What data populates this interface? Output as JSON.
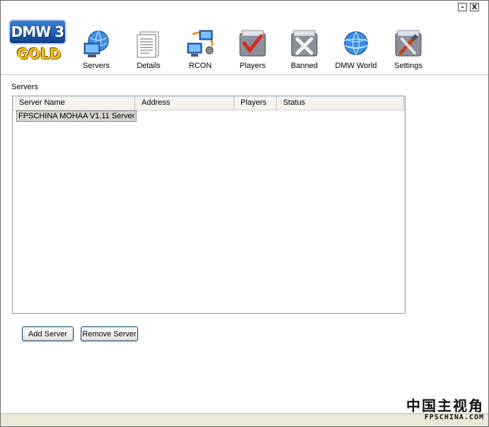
{
  "window": {
    "minimize_label": "-",
    "close_label": "X"
  },
  "logo": {
    "title": "DMW 3",
    "subtitle": "GOLD"
  },
  "toolbar": {
    "items": [
      {
        "label": "Servers",
        "icon": "globe-computer-icon"
      },
      {
        "label": "Details",
        "icon": "document-details-icon"
      },
      {
        "label": "RCON",
        "icon": "computers-network-icon"
      },
      {
        "label": "Players",
        "icon": "folder-check-icon"
      },
      {
        "label": "Banned",
        "icon": "folder-x-icon"
      },
      {
        "label": "DMW World",
        "icon": "globe-icon"
      },
      {
        "label": "Settings",
        "icon": "folder-tools-icon"
      }
    ]
  },
  "servers": {
    "group_label": "Servers",
    "columns": [
      "Server Name",
      "Address",
      "Players",
      "Status"
    ],
    "rows": [
      {
        "name": "FPSCHINA MOHAA V1.11 Server",
        "address": "",
        "players": "",
        "status": ""
      }
    ]
  },
  "buttons": {
    "add": "Add Server",
    "remove": "Remove Server"
  },
  "watermark": {
    "cn": "中国主视角",
    "en": "FPSCHINA.COM"
  }
}
